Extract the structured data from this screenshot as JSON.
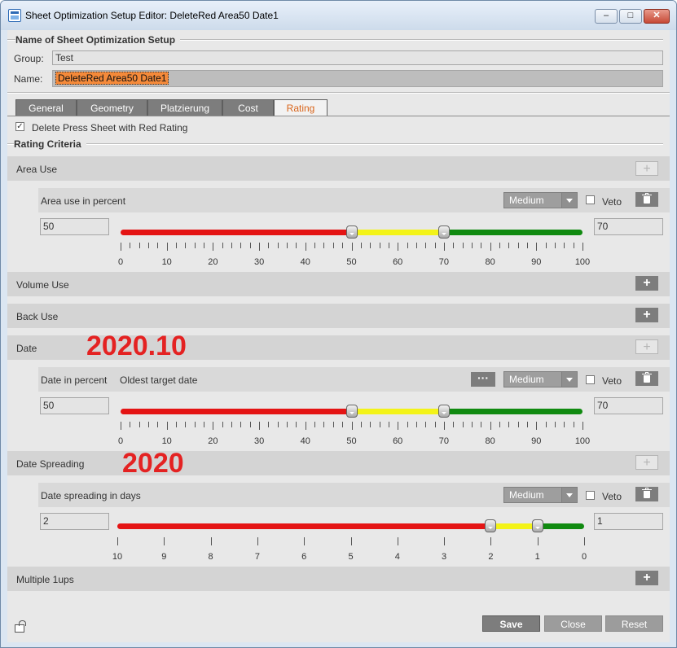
{
  "window": {
    "title": "Sheet Optimization Setup Editor: DeleteRed Area50 Date1"
  },
  "name_section": {
    "title": "Name of Sheet Optimization Setup",
    "group_label": "Group:",
    "group_value": "Test",
    "name_label": "Name:",
    "name_value": "DeleteRed Area50 Date1"
  },
  "tabs": [
    {
      "label": "General"
    },
    {
      "label": "Geometry"
    },
    {
      "label": "Platzierung"
    },
    {
      "label": "Cost"
    },
    {
      "label": "Rating",
      "active": true
    }
  ],
  "delete_red": {
    "label": "Delete Press Sheet with Red Rating",
    "checked": true,
    "check_glyph": "✓"
  },
  "criteria_title": "Rating Criteria",
  "criteria": {
    "area_use": {
      "title": "Area Use",
      "add_enabled": false,
      "item": {
        "label": "Area use in percent",
        "priority": "Medium",
        "veto_label": "Veto",
        "veto_checked": false,
        "low_value": "50",
        "high_value": "70",
        "scale_min": 0,
        "scale_max": 100,
        "red_until": 50,
        "yellow_until": 70,
        "ticks": [
          "0",
          "10",
          "20",
          "30",
          "40",
          "50",
          "60",
          "70",
          "80",
          "90",
          "100"
        ]
      }
    },
    "volume_use": {
      "title": "Volume Use",
      "add_enabled": true
    },
    "back_use": {
      "title": "Back Use",
      "add_enabled": true
    },
    "date": {
      "title": "Date",
      "add_enabled": false,
      "item": {
        "label": "Date in percent",
        "extra_label": "Oldest target date",
        "more_button": "···",
        "priority": "Medium",
        "veto_label": "Veto",
        "veto_checked": false,
        "low_value": "50",
        "high_value": "70",
        "scale_min": 0,
        "scale_max": 100,
        "red_until": 50,
        "yellow_until": 70,
        "ticks": [
          "0",
          "10",
          "20",
          "30",
          "40",
          "50",
          "60",
          "70",
          "80",
          "90",
          "100"
        ]
      }
    },
    "date_spreading": {
      "title": "Date Spreading",
      "add_enabled": false,
      "item": {
        "label": "Date spreading in days",
        "priority": "Medium",
        "veto_label": "Veto",
        "veto_checked": false,
        "low_value": "2",
        "high_value": "1",
        "scale_min": 10,
        "scale_max": 0,
        "red_until": 2,
        "yellow_until": 1,
        "ticks": [
          "10",
          "9",
          "8",
          "7",
          "6",
          "5",
          "4",
          "3",
          "2",
          "1",
          "0"
        ]
      }
    },
    "multiple_1ups": {
      "title": "Multiple 1ups",
      "add_enabled": true
    }
  },
  "annotations": {
    "date_note": "2020.10",
    "spreading_note": "2020"
  },
  "buttons": {
    "save": "Save",
    "close": "Close",
    "reset": "Reset"
  },
  "icons": {
    "plus": "+",
    "minimize": "–",
    "maximize": "□",
    "close": "✕"
  },
  "colors": {
    "red": "#e41414",
    "yellow": "#f3f318",
    "green": "#108a10",
    "accent_tab": "#d9651b"
  }
}
